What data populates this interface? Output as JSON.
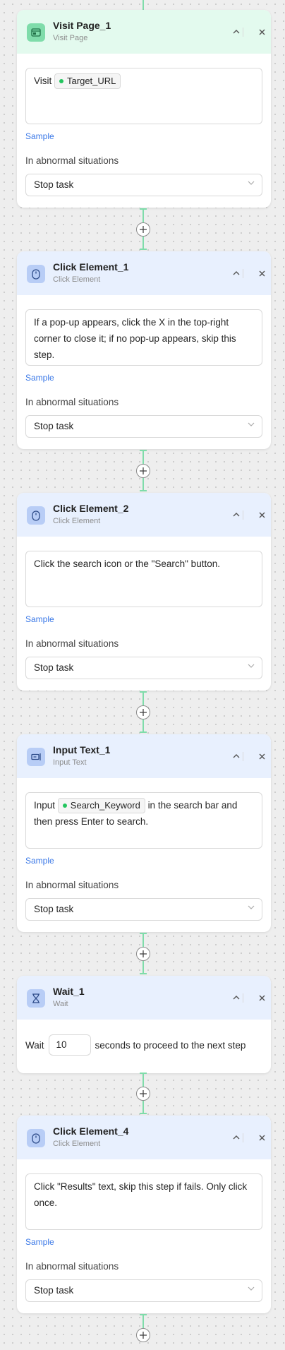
{
  "colors": {
    "connector": "#7fdcaa",
    "link": "#3a78e7",
    "visit_header": "#e3faee",
    "click_header": "#e8f0fe"
  },
  "common": {
    "sample_label": "Sample",
    "abnormal_label": "In abnormal situations",
    "abnormal_value": "Stop task"
  },
  "steps": {
    "visit_page_1": {
      "title": "Visit Page_1",
      "subtitle": "Visit Page",
      "icon": "browser-window-icon",
      "prompt_prefix": "Visit",
      "variable": "Target_URL"
    },
    "click_element_1": {
      "title": "Click Element_1",
      "subtitle": "Click Element",
      "icon": "mouse-icon",
      "prompt": "If a pop-up appears, click the X in the top-right corner to close it; if no pop-up appears, skip this step."
    },
    "click_element_2": {
      "title": "Click Element_2",
      "subtitle": "Click Element",
      "icon": "mouse-icon",
      "prompt": "Click the search icon or the \"Search\" button."
    },
    "input_text_1": {
      "title": "Input Text_1",
      "subtitle": "Input Text",
      "icon": "keyboard-input-icon",
      "prompt_prefix": "Input",
      "variable": "Search_Keyword",
      "prompt_suffix": "in the search bar and then press Enter to search."
    },
    "wait_1": {
      "title": "Wait_1",
      "subtitle": "Wait",
      "icon": "hourglass-icon",
      "prefix": "Wait",
      "value": "10",
      "suffix": "seconds to proceed to the next step"
    },
    "click_element_4": {
      "title": "Click Element_4",
      "subtitle": "Click Element",
      "icon": "mouse-icon",
      "prompt": "Click \"Results\" text, skip this step if fails. Only click once."
    }
  }
}
